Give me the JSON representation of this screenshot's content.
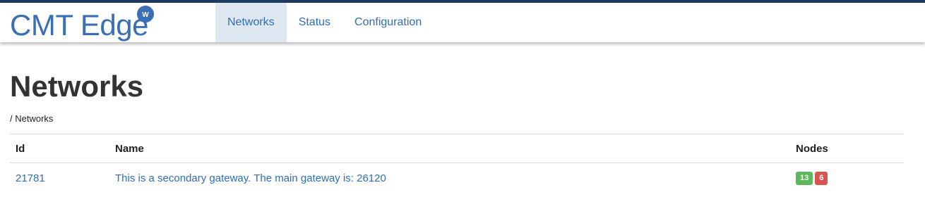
{
  "brand": {
    "text": "CMT Edge",
    "logo_letter": "W",
    "color": "#3a6fb5"
  },
  "nav": {
    "items": [
      {
        "label": "Networks",
        "active": true
      },
      {
        "label": "Status",
        "active": false
      },
      {
        "label": "Configuration",
        "active": false
      }
    ]
  },
  "page": {
    "title": "Networks",
    "breadcrumb": "/ Networks"
  },
  "table": {
    "headers": [
      "Id",
      "Name",
      "Nodes"
    ],
    "rows": [
      {
        "id": "21781",
        "name": "This is a secondary gateway. The main gateway is: 26120",
        "nodes_up": "13",
        "nodes_down": "6"
      }
    ]
  },
  "colors": {
    "link": "#2f6db5",
    "badge_up": "#5cb85c",
    "badge_down": "#d9534f",
    "nav_active_bg": "#dde8f3",
    "topbar_border": "#1f3a5f"
  }
}
